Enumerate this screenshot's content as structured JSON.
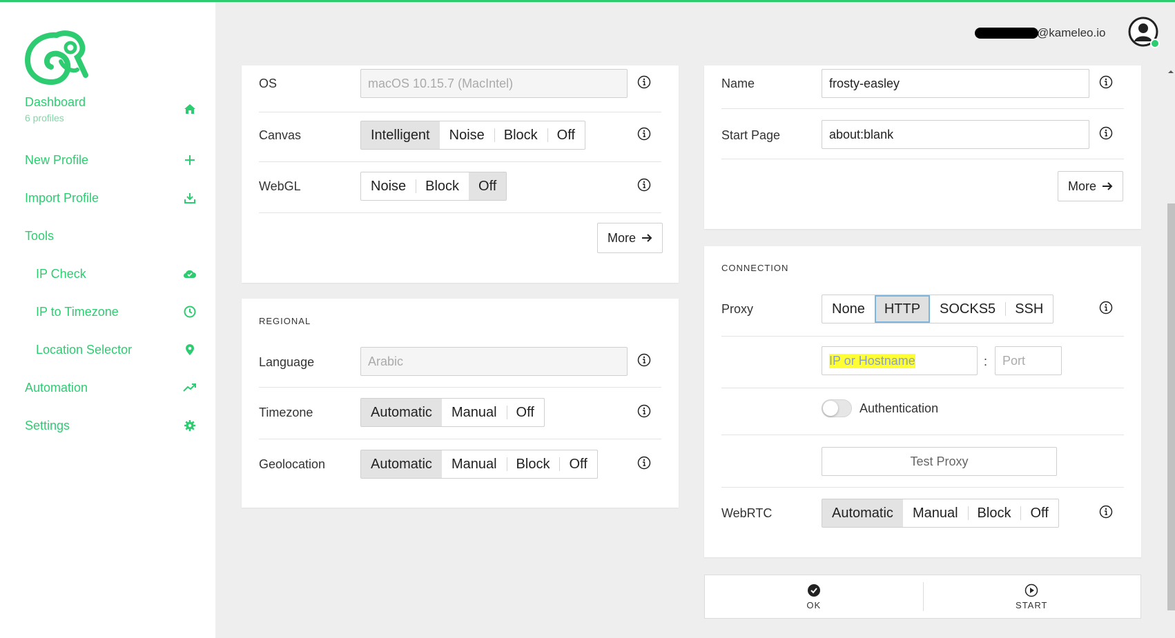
{
  "user": {
    "email": "@kameleo.io"
  },
  "sidebar": {
    "items": [
      {
        "label": "Dashboard",
        "sub": "6 profiles",
        "icon": "home-icon"
      },
      {
        "label": "New Profile",
        "icon": "plus-icon"
      },
      {
        "label": "Import Profile",
        "icon": "download-icon"
      },
      {
        "label": "Tools",
        "icon": ""
      },
      {
        "label": "IP Check",
        "icon": "cloud-check-icon"
      },
      {
        "label": "IP to Timezone",
        "icon": "clock-icon"
      },
      {
        "label": "Location Selector",
        "icon": "map-pin-icon"
      },
      {
        "label": "Automation",
        "icon": "trend-icon"
      },
      {
        "label": "Settings",
        "icon": "gear-icon"
      }
    ]
  },
  "fingerprint": {
    "os_label": "OS",
    "os_value": "macOS 10.15.7 (MacIntel)",
    "canvas_label": "Canvas",
    "canvas_options": [
      "Intelligent",
      "Noise",
      "Block",
      "Off"
    ],
    "canvas_selected": "Intelligent",
    "webgl_label": "WebGL",
    "webgl_options": [
      "Noise",
      "Block",
      "Off"
    ],
    "webgl_selected": "Off",
    "more_label": "More"
  },
  "regional": {
    "title": "REGIONAL",
    "language_label": "Language",
    "language_value": "Arabic",
    "timezone_label": "Timezone",
    "timezone_options": [
      "Automatic",
      "Manual",
      "Off"
    ],
    "timezone_selected": "Automatic",
    "geolocation_label": "Geolocation",
    "geolocation_options": [
      "Automatic",
      "Manual",
      "Block",
      "Off"
    ],
    "geolocation_selected": "Automatic"
  },
  "general": {
    "name_label": "Name",
    "name_value": "frosty-easley",
    "start_page_label": "Start Page",
    "start_page_value": "about:blank",
    "more_label": "More"
  },
  "connection": {
    "title": "CONNECTION",
    "proxy_label": "Proxy",
    "proxy_options": [
      "None",
      "HTTP",
      "SOCKS5",
      "SSH"
    ],
    "proxy_selected": "HTTP",
    "host_placeholder": "IP or Hostname",
    "separator": ":",
    "port_placeholder": "Port",
    "auth_label": "Authentication",
    "auth_enabled": false,
    "test_proxy_label": "Test Proxy",
    "webrtc_label": "WebRTC",
    "webrtc_options": [
      "Automatic",
      "Manual",
      "Block",
      "Off"
    ],
    "webrtc_selected": "Automatic"
  },
  "actions": {
    "ok_label": "OK",
    "start_label": "START"
  },
  "colors": {
    "accent": "#2ecc71",
    "highlight": "#ffff33"
  }
}
